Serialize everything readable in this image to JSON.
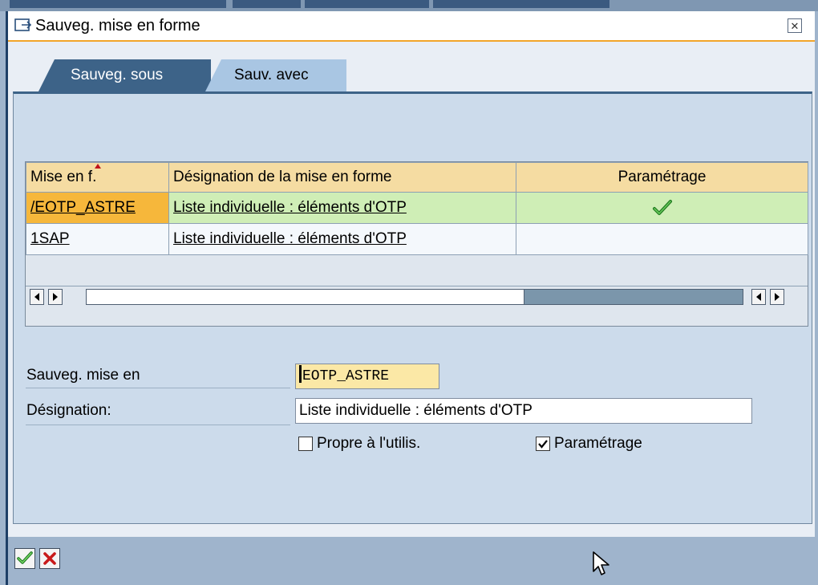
{
  "dialog": {
    "title": "Sauveg. mise en forme",
    "close_icon": "close-icon"
  },
  "tabs": [
    {
      "label": "Sauveg. sous",
      "active": true
    },
    {
      "label": "Sauv. avec",
      "active": false
    }
  ],
  "table": {
    "columns": [
      "Mise en f.",
      "Désignation de la mise en forme",
      "Paramétrage"
    ],
    "rows": [
      {
        "layout": "/EOTP_ASTRE",
        "designation": "Liste individuelle : éléments d'OTP",
        "parametrage": "checkmark",
        "selected": true
      },
      {
        "layout": "1SAP",
        "designation": "Liste individuelle : éléments d'OTP",
        "parametrage": "",
        "selected": false
      }
    ]
  },
  "form": {
    "save_label": "Sauveg. mise en",
    "save_value": "EOTP_ASTRE",
    "designation_label": "Désignation:",
    "designation_value": "Liste individuelle : éléments d'OTP",
    "user_specific_label": "Propre à l'utilis.",
    "user_specific_checked": false,
    "default_label": "Paramétrage",
    "default_checked": true
  },
  "footer": {
    "confirm_icon": "checkmark-icon",
    "cancel_icon": "cancel-x-icon"
  },
  "colors": {
    "accent": "#3d6388",
    "selected_row": "#cfeeb6",
    "selected_key": "#f6b73b",
    "header": "#f5dca2"
  }
}
